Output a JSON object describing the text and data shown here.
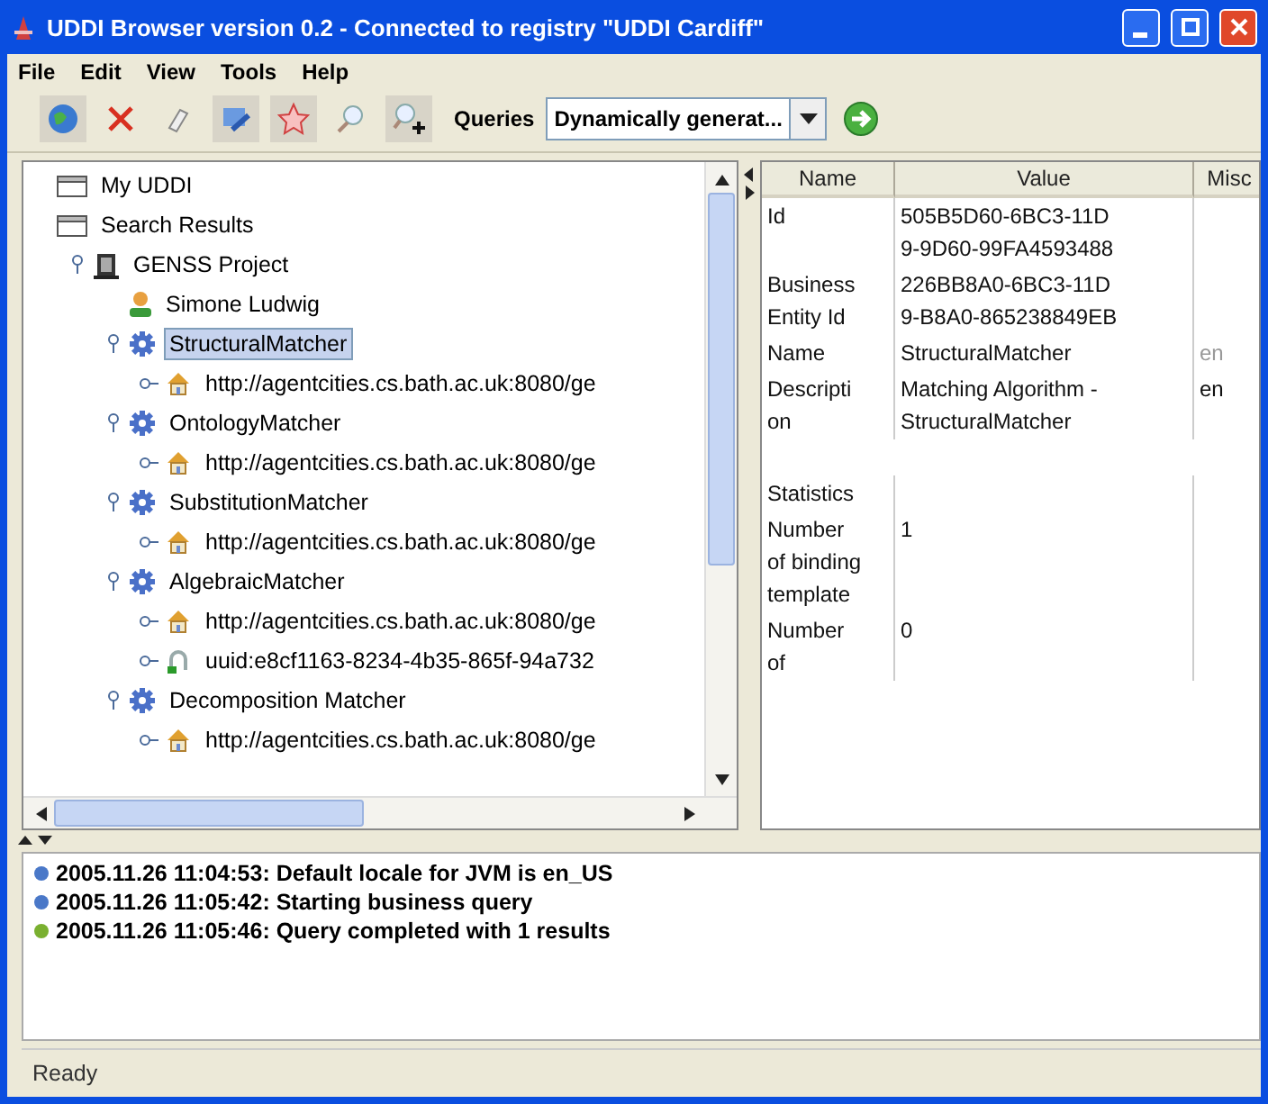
{
  "window": {
    "title": "UDDI Browser version 0.2 - Connected to registry \"UDDI Cardiff\""
  },
  "menu": [
    "File",
    "Edit",
    "View",
    "Tools",
    "Help"
  ],
  "toolbar": {
    "queries_label": "Queries",
    "queries_value": "Dynamically generat..."
  },
  "tree": [
    {
      "label": "My UDDI",
      "kind": "folder",
      "selected": false
    },
    {
      "label": "Search Results",
      "kind": "folder",
      "selected": false,
      "children": [
        {
          "label": "GENSS Project",
          "kind": "business",
          "selected": false,
          "expanded": true,
          "children": [
            {
              "label": "Simone Ludwig",
              "kind": "person",
              "selected": false
            },
            {
              "label": "StructuralMatcher",
              "kind": "service",
              "selected": true,
              "expanded": true,
              "children": [
                {
                  "label": "http://agentcities.cs.bath.ac.uk:8080/ge",
                  "kind": "binding",
                  "selected": false,
                  "expanded": false
                }
              ]
            },
            {
              "label": "OntologyMatcher",
              "kind": "service",
              "selected": false,
              "expanded": true,
              "children": [
                {
                  "label": "http://agentcities.cs.bath.ac.uk:8080/ge",
                  "kind": "binding",
                  "selected": false,
                  "expanded": false
                }
              ]
            },
            {
              "label": "SubstitutionMatcher",
              "kind": "service",
              "selected": false,
              "expanded": true,
              "children": [
                {
                  "label": "http://agentcities.cs.bath.ac.uk:8080/ge",
                  "kind": "binding",
                  "selected": false,
                  "expanded": false
                }
              ]
            },
            {
              "label": "AlgebraicMatcher",
              "kind": "service",
              "selected": false,
              "expanded": true,
              "children": [
                {
                  "label": "http://agentcities.cs.bath.ac.uk:8080/ge",
                  "kind": "binding",
                  "selected": false,
                  "expanded": false
                },
                {
                  "label": "uuid:e8cf1163-8234-4b35-865f-94a732",
                  "kind": "model",
                  "selected": false,
                  "expanded": false
                }
              ]
            },
            {
              "label": "Decomposition Matcher",
              "kind": "service",
              "selected": false,
              "expanded": true,
              "children": [
                {
                  "label": "http://agentcities.cs.bath.ac.uk:8080/ge",
                  "kind": "binding",
                  "selected": false,
                  "expanded": false
                }
              ]
            }
          ]
        }
      ]
    }
  ],
  "table": {
    "columns": [
      "Name",
      "Value",
      "Misc"
    ],
    "rows": [
      {
        "name": "Id",
        "value": "505B5D60-6BC3-11D\n9-9D60-99FA4593488"
      },
      {
        "name": "Business\nEntity Id",
        "value": "226BB8A0-6BC3-11D\n9-B8A0-865238849EB"
      },
      {
        "name": "Name",
        "value": "StructuralMatcher",
        "misc": "en",
        "misc_dimmed": true
      },
      {
        "name": "Descripti\non",
        "value": "Matching Algorithm -\nStructuralMatcher",
        "misc": "en",
        "misc_dimmed": false
      },
      {
        "name": "Statistics",
        "kind": "section"
      },
      {
        "name": "Number\nof binding\ntemplate",
        "value": "1"
      },
      {
        "name": "Number\nof",
        "value": "0"
      }
    ]
  },
  "log": [
    {
      "text": "2005.11.26 11:04:53: Default locale for JVM is en_US",
      "color": "#4a78c8"
    },
    {
      "text": "2005.11.26 11:05:42: Starting business query",
      "color": "#4a78c8"
    },
    {
      "text": "2005.11.26 11:05:46: Query completed with 1 results",
      "color": "#7ab030"
    }
  ],
  "status_bar": "Ready"
}
